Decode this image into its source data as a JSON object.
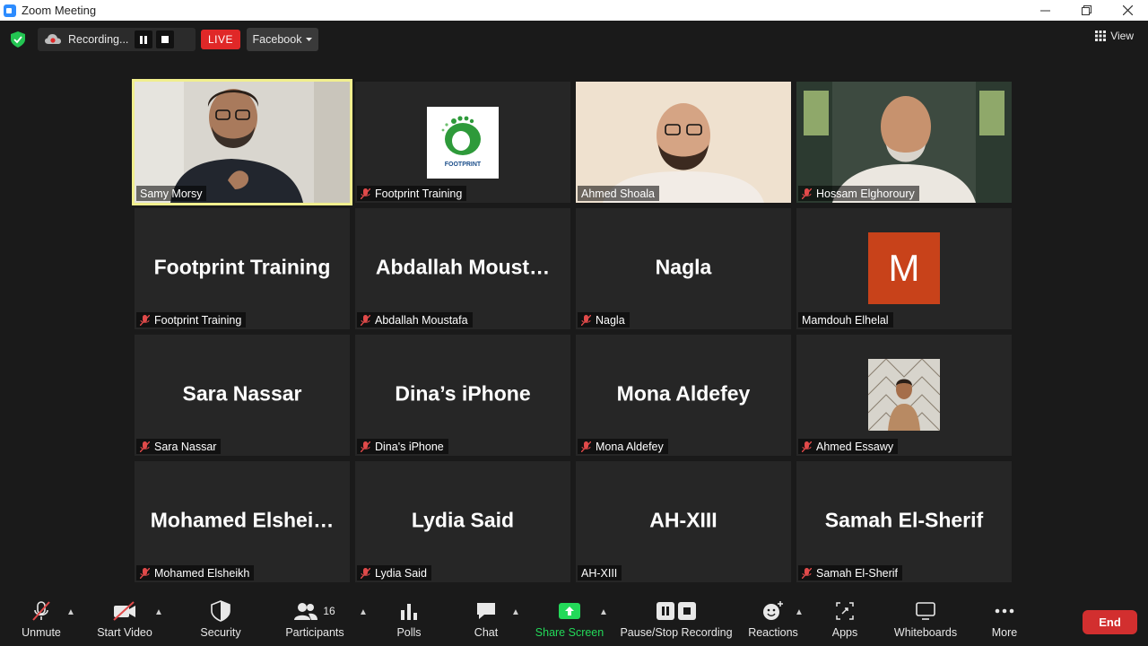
{
  "window": {
    "title": "Zoom Meeting"
  },
  "topbar": {
    "recording_label": "Recording...",
    "live_label": "LIVE",
    "stream_target": "Facebook",
    "view_label": "View"
  },
  "tiles": [
    {
      "label": "Samy Morsy",
      "kind": "video",
      "muted": false,
      "active": true
    },
    {
      "label": "Footprint Training",
      "kind": "logo",
      "muted": true,
      "logo_text": "FOOTPRINT"
    },
    {
      "label": "Ahmed Shoala",
      "kind": "video",
      "muted": false
    },
    {
      "label": "Hossam Elghoroury",
      "kind": "video",
      "muted": true
    },
    {
      "label": "Footprint Training",
      "big": "Footprint Training",
      "kind": "name",
      "muted": true
    },
    {
      "label": "Abdallah Moustafa",
      "big": "Abdallah  Moust…",
      "kind": "name",
      "muted": true
    },
    {
      "label": "Nagla",
      "big": "Nagla",
      "kind": "name",
      "muted": true
    },
    {
      "label": "Mamdouh Elhelal",
      "kind": "avatar-letter",
      "letter": "M",
      "muted": false
    },
    {
      "label": "Sara Nassar",
      "big": "Sara Nassar",
      "kind": "name",
      "muted": true
    },
    {
      "label": "Dina's iPhone",
      "big": "Dina’s iPhone",
      "kind": "name",
      "muted": true
    },
    {
      "label": "Mona Aldefey",
      "big": "Mona Aldefey",
      "kind": "name",
      "muted": true
    },
    {
      "label": "Ahmed Essawy",
      "kind": "avatar-photo",
      "muted": true
    },
    {
      "label": "Mohamed Elsheikh",
      "big": "Mohamed  Elshei…",
      "kind": "name",
      "muted": true
    },
    {
      "label": "Lydia Said",
      "big": "Lydia Said",
      "kind": "name",
      "muted": true
    },
    {
      "label": "AH-XIII",
      "big": "AH-XIII",
      "kind": "name",
      "muted": false
    },
    {
      "label": "Samah El-Sherif",
      "big": "Samah El-Sherif",
      "kind": "name",
      "muted": true
    }
  ],
  "toolbar": {
    "unmute": "Unmute",
    "start_video": "Start Video",
    "security": "Security",
    "participants": "Participants",
    "participants_count": "16",
    "polls": "Polls",
    "chat": "Chat",
    "share_screen": "Share Screen",
    "pause_recording": "Pause/Stop Recording",
    "reactions": "Reactions",
    "apps": "Apps",
    "whiteboards": "Whiteboards",
    "more": "More",
    "end": "End"
  },
  "colors": {
    "active_speaker": "#f1ef8e",
    "share_green": "#23d959",
    "end_red": "#d22f2f",
    "live_red": "#e02828",
    "avatar_orange": "#c8421a"
  }
}
